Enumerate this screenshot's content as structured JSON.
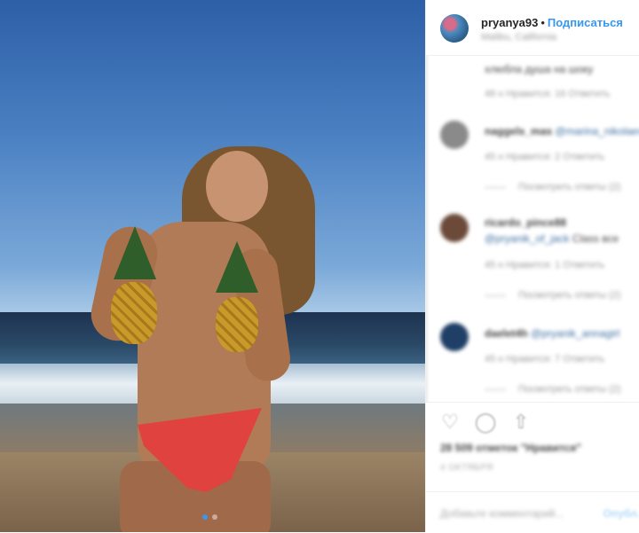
{
  "post": {
    "username": "pryanya93",
    "separator": "•",
    "follow_label": "Подписаться",
    "location": "Malibu, California"
  },
  "photo": {
    "carousel_count": 2,
    "carousel_active": 1
  },
  "comments": [
    {
      "text": "хлюбла душа на шоку",
      "meta": "48 н     Нравится: 16     Ответить"
    },
    {
      "username": "naggels_mas",
      "mention": "@marina_nikolaeva",
      "meta": "45 н     Нравится: 2     Ответить",
      "replies": "Посмотреть ответы (2)"
    },
    {
      "username": "ricardo_pince88",
      "mention": "@pryanik_of_jack",
      "text": "Class все",
      "meta": "45 н     Нравится: 1     Ответить",
      "replies": "Посмотреть ответы (2)"
    },
    {
      "username": "daelet4h",
      "mention": "@pryanik_annagirl",
      "meta": "45 н     Нравится: 7     Ответить",
      "replies": "Посмотреть ответы (2)"
    }
  ],
  "actions": {
    "like_icon": "heart-icon",
    "comment_icon": "comment-icon",
    "share_icon": "share-icon",
    "likes_text": "28 509 отметок \"Нравится\"",
    "date": "4 ОКТЯБРЯ",
    "add_comment_placeholder": "Добавьте комментарий...",
    "post_label": "Опубл."
  },
  "colors": {
    "accent": "#3897f0",
    "text": "#262626",
    "muted": "#999999",
    "bikini": "#e0433f"
  }
}
